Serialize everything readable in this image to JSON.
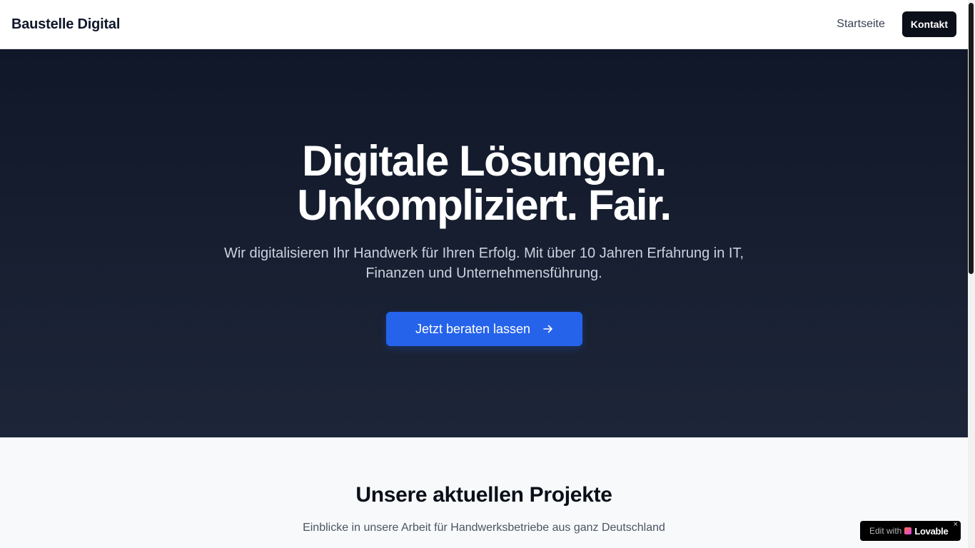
{
  "header": {
    "brand": "Baustelle Digital",
    "nav": {
      "home": "Startseite",
      "contact": "Kontakt"
    }
  },
  "hero": {
    "title_line1": "Digitale Lösungen.",
    "title_line2": "Unkompliziert. Fair.",
    "subtitle": "Wir digitalisieren Ihr Handwerk für Ihren Erfolg. Mit über 10 Jahren Erfahrung in IT, Finanzen und Unternehmensführung.",
    "cta_label": "Jetzt beraten lassen",
    "cta_icon": "arrow-right-icon"
  },
  "projects": {
    "title": "Unsere aktuellen Projekte",
    "subtitle": "Einblicke in unsere Arbeit für Handwerksbetriebe aus ganz Deutschland"
  },
  "badge": {
    "label": "Edit with",
    "brand": "Lovable",
    "close": "×"
  },
  "colors": {
    "hero_bg_top": "#101729",
    "hero_bg_bottom": "#1d2638",
    "accent": "#2563eb",
    "dark": "#0b0f19"
  }
}
